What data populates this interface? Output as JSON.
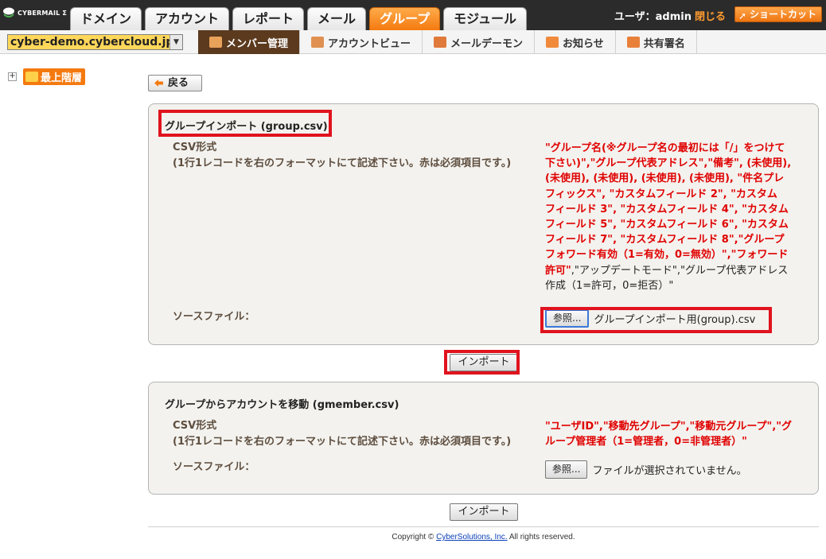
{
  "app": {
    "logo_text": "CYBERMAIL Σ",
    "tabs": [
      {
        "label": "ドメイン",
        "active": false
      },
      {
        "label": "アカウント",
        "active": false
      },
      {
        "label": "レポート",
        "active": false
      },
      {
        "label": "メール",
        "active": false
      },
      {
        "label": "グループ",
        "active": true
      },
      {
        "label": "モジュール",
        "active": false
      }
    ],
    "user_label": "ユーザ：admin",
    "close_label": "閉じる",
    "shortcut_label": "ショートカット"
  },
  "subbar": {
    "domain_value": "cyber-demo.cybercloud.jp",
    "nav": [
      {
        "label": "メンバー管理",
        "icon": "members-icon",
        "active": true
      },
      {
        "label": "アカウントビュー",
        "icon": "account-view-icon",
        "active": false
      },
      {
        "label": "メールデーモン",
        "icon": "mail-daemon-icon",
        "active": false
      },
      {
        "label": "お知らせ",
        "icon": "notice-icon",
        "active": false
      },
      {
        "label": "共有署名",
        "icon": "signature-icon",
        "active": false
      }
    ]
  },
  "tree": {
    "root_label": "最上階層",
    "expander": "+"
  },
  "back_label": "戻る",
  "import1": {
    "title": "グループインポート (group.csv)",
    "csv_label": "CSV形式",
    "csv_note": "(1行1レコードを右のフォーマットにて記述下さい。赤は必須項目です。)",
    "format_lines": [
      "\"グループ名(※グループ名の最初には「/」をつけて",
      "下さい)\",\"グループ代表アドレス\",\"備考\", (未使用),",
      "(未使用), (未使用), (未使用), (未使用), \"件名プレ",
      "フィックス\", \"カスタムフィールド 2\", \"カスタム",
      "フィールド 3\", \"カスタムフィールド 4\", \"カスタム",
      "フィールド 5\", \"カスタムフィールド 6\", \"カスタム",
      "フィールド 7\", \"カスタムフィールド 8\",\"グループ",
      "フォワード有効（1=有効，0=無効）\",\"フォワード"
    ],
    "format_line9_red": "許可\"",
    "format_line9_black": ",\"アップデートモード\",\"グループ代表アドレス",
    "format_line10_black": "作成（1=許可，0=拒否）\"",
    "source_label": "ソースファイル：",
    "browse_label": "参照...",
    "file_name": "グループインポート用(group).csv",
    "import_label": "インポート"
  },
  "import2": {
    "title": "グループからアカウントを移動 (gmember.csv)",
    "csv_label": "CSV形式",
    "csv_note": "(1行1レコードを右のフォーマットにて記述下さい。赤は必須項目です。)",
    "format_lines": [
      "\"ユーザID\",\"移動先グループ\",\"移動元グループ\",\"グ",
      "ループ管理者（1=管理者，0=非管理者）\""
    ],
    "source_label": "ソースファイル：",
    "browse_label": "参照...",
    "file_name": "ファイルが選択されていません。",
    "import_label": "インポート"
  },
  "footer": {
    "prefix": "Copyright © ",
    "link": "CyberSolutions, Inc.",
    "suffix": " All rights reserved."
  },
  "colors": {
    "accent": "#f47a10",
    "highlight_box": "#e0131e",
    "required": "#e00000"
  }
}
